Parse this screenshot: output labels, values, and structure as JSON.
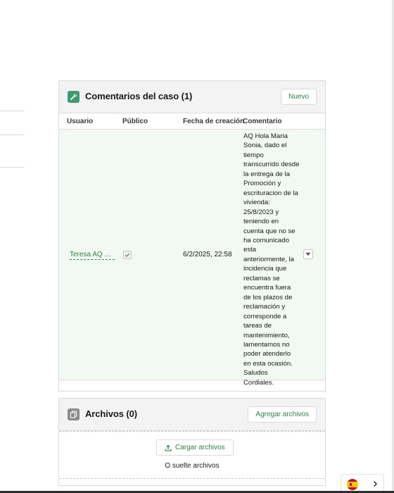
{
  "comments_card": {
    "title": "Comentarios del caso (1)",
    "new_button": "Nuevo",
    "columns": [
      "Usuario",
      "Público",
      "Fecha de creación",
      "Comentario"
    ],
    "rows": [
      {
        "user": "Teresa AQ Ac...",
        "public": true,
        "created": "6/2/2025, 22:58",
        "comment": "AQ Hola Maria Sonia, dado el tiempo transcurrido desde la entrega de la Promoción y escrituracion de la vivienda: 25/8/2023 y teniendo en cuenta que no se ha comunicado esta anteriormente, la incidencia que reclamas se encuentra fuera de los plazos de reclamación y corresponde a tareas de mantenimiento, lamentamos no poder atenderlo en esta ocasión. Saludos Cordiales."
      }
    ]
  },
  "files_card": {
    "title": "Archivos (0)",
    "add_button": "Agregar archivos",
    "upload_button": "Cargar archivos",
    "drop_text": "O suelte archivos"
  },
  "language": {
    "flag": "spain-flag-icon"
  },
  "colors": {
    "accent": "#2e844a",
    "row_highlight": "#f2f9f2",
    "icon_green": "#3d9b6e",
    "icon_gray": "#8a8a8a"
  }
}
